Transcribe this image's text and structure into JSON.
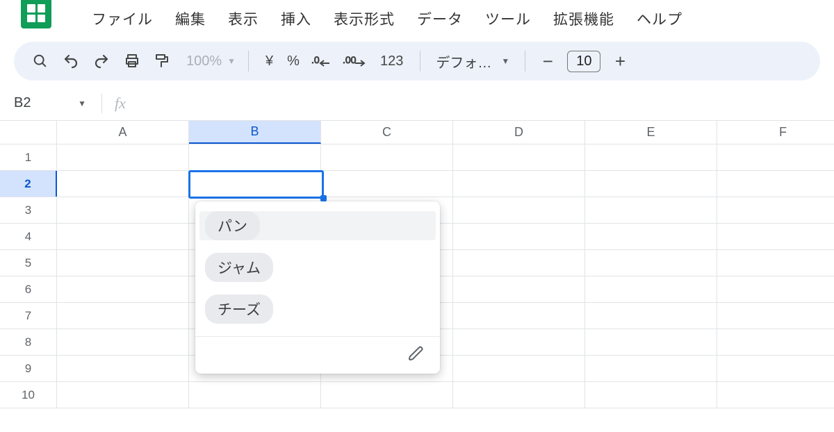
{
  "menu": {
    "items": [
      "ファイル",
      "編集",
      "表示",
      "挿入",
      "表示形式",
      "データ",
      "ツール",
      "拡張機能",
      "ヘルプ"
    ]
  },
  "toolbar": {
    "zoom": "100%",
    "currency_symbol": "¥",
    "percent_symbol": "%",
    "number_format_label": "123",
    "font_name": "デフォ…",
    "font_size": "10"
  },
  "namebox": {
    "ref": "B2"
  },
  "columns": [
    "A",
    "B",
    "C",
    "D",
    "E",
    "F"
  ],
  "rows": [
    "1",
    "2",
    "3",
    "4",
    "5",
    "6",
    "7",
    "8",
    "9",
    "10"
  ],
  "selected": {
    "col_index": 1,
    "row_index": 1
  },
  "dropdown": {
    "options": [
      "パン",
      "ジャム",
      "チーズ"
    ],
    "highlight_index": 0
  }
}
